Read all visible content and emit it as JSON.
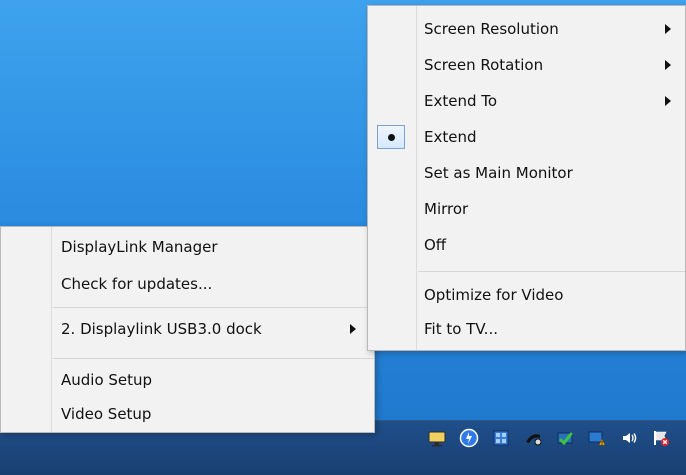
{
  "tray_menu": {
    "items": [
      {
        "label": "DisplayLink Manager"
      },
      {
        "label": "Check for updates..."
      },
      {
        "label": "2. Displaylink USB3.0 dock",
        "has_submenu": true
      },
      {
        "label": "Audio Setup"
      },
      {
        "label": "Video Setup"
      }
    ]
  },
  "dock_submenu": {
    "items": [
      {
        "label": "Screen Resolution",
        "has_submenu": true
      },
      {
        "label": "Screen Rotation",
        "has_submenu": true
      },
      {
        "label": "Extend To",
        "has_submenu": true
      },
      {
        "label": "Extend",
        "checked": true
      },
      {
        "label": "Set as Main Monitor"
      },
      {
        "label": "Mirror"
      },
      {
        "label": "Off"
      },
      {
        "label": "Optimize for Video"
      },
      {
        "label": "Fit to TV..."
      }
    ]
  },
  "taskbar": {
    "tray_icons": [
      "display-icon",
      "update-icon",
      "app-icon",
      "network-activity-icon",
      "security-shield-icon",
      "wifi-warning-icon",
      "speaker-icon",
      "action-center-flag-icon"
    ]
  },
  "colors": {
    "menu_bg": "#f2f2f2",
    "menu_border": "#b8b8b8",
    "checked_bg": "#d6e8ff",
    "desktop_top": "#3ea3ee",
    "taskbar": "#1f4f8a"
  }
}
